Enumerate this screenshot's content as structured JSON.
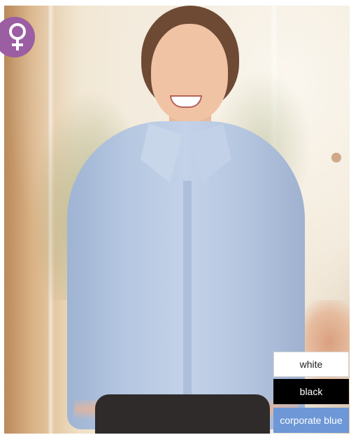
{
  "product": {
    "gender_icon": "female-symbol-icon",
    "badge_color": "#9b5ea2"
  },
  "colors": [
    {
      "label": "white",
      "swatch": "#ffffff",
      "text": "#222222"
    },
    {
      "label": "black",
      "swatch": "#000000",
      "text": "#ffffff"
    },
    {
      "label": "corporate blue",
      "swatch": "#6d97d6",
      "text": "#ffffff"
    }
  ]
}
